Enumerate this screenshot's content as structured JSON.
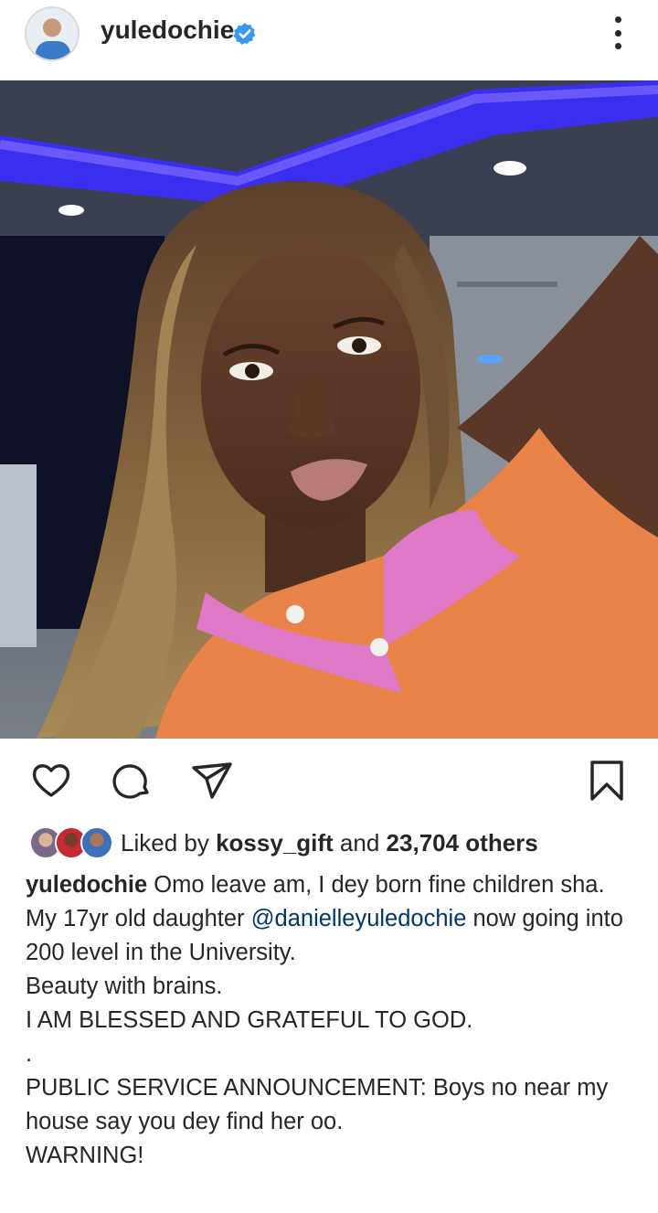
{
  "header": {
    "username": "yuledochie",
    "avatar_icon": "profile-avatar",
    "verified_icon": "verified-badge-icon",
    "more_icon": "more-options-icon"
  },
  "post": {
    "image_alt": "photo",
    "actions": {
      "like_icon": "heart-icon",
      "comment_icon": "comment-icon",
      "share_icon": "send-icon",
      "save_icon": "bookmark-icon"
    },
    "likes": {
      "prefix": "Liked by",
      "user": "kossy_gift",
      "middle": "and",
      "count": "23,704 others"
    },
    "caption": {
      "username": "yuledochie",
      "line1": "Omo leave am, I dey born fine children sha.",
      "line2_pre": "My 17yr old daughter",
      "mention": "@danielleyuledochie",
      "line2_post": "now going into 200 level in the University.",
      "line3": "Beauty with brains.",
      "line4": "I AM BLESSED AND GRATEFUL TO GOD.",
      "line5": ".",
      "line6": "PUBLIC SERVICE ANNOUNCEMENT: Boys no near my house say you dey find her oo.",
      "line7": "WARNING!"
    }
  },
  "colors": {
    "text": "#262626",
    "mention": "#00376b",
    "verified": "#3897f0",
    "ceiling_light": "#3d2cff",
    "shirt": "#e8834a",
    "collar": "#e07ac8"
  }
}
